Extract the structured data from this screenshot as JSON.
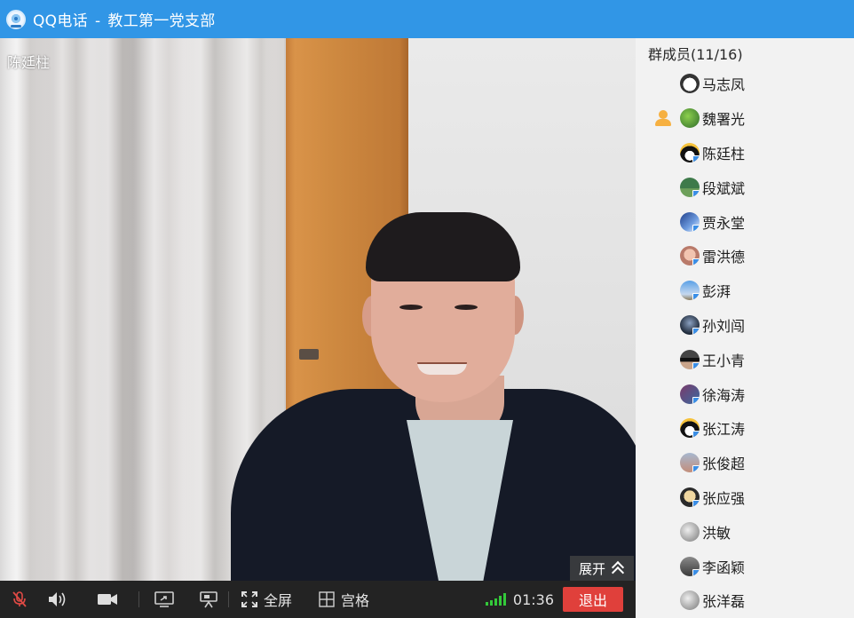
{
  "window": {
    "app_name": "QQ电话",
    "separator": "-",
    "group_name": "教工第一党支部"
  },
  "video": {
    "speaker_name": "陈廷柱",
    "expand_label": "展开"
  },
  "toolbar": {
    "fullscreen_label": "全屏",
    "grid_label": "宫格",
    "call_duration": "01:36",
    "quit_label": "退出",
    "signal_color": "#33c93a",
    "quit_color": "#e0403b"
  },
  "members": {
    "title": "群成员(11/16)",
    "items": [
      {
        "name": "马志凤",
        "avatar": "panda-avatar",
        "speaking": false
      },
      {
        "name": "魏署光",
        "avatar": "green-avatar",
        "speaking": true
      },
      {
        "name": "陈廷柱",
        "avatar": "penguin-avatar",
        "speaking": false
      },
      {
        "name": "段斌斌",
        "avatar": "landscape-avatar",
        "speaking": false
      },
      {
        "name": "贾永堂",
        "avatar": "blue-photo-avatar",
        "speaking": false
      },
      {
        "name": "雷洪德",
        "avatar": "face-avatar",
        "speaking": false
      },
      {
        "name": "彭湃",
        "avatar": "blue-sky-avatar",
        "speaking": false
      },
      {
        "name": "孙刘闯",
        "avatar": "dark-photo-avatar",
        "speaking": false
      },
      {
        "name": "王小青",
        "avatar": "sunglasses-avatar",
        "speaking": false
      },
      {
        "name": "徐海涛",
        "avatar": "group-photo-avatar",
        "speaking": false
      },
      {
        "name": "张江涛",
        "avatar": "penguin-avatar",
        "speaking": false
      },
      {
        "name": "张俊超",
        "avatar": "crowd-avatar",
        "speaking": false
      },
      {
        "name": "张应强",
        "avatar": "cartoon-avatar",
        "speaking": false
      },
      {
        "name": "洪敏",
        "avatar": "gray-avatar",
        "speaking": false
      },
      {
        "name": "李函颖",
        "avatar": "street-avatar",
        "speaking": false
      },
      {
        "name": "张洋磊",
        "avatar": "gray-avatar",
        "speaking": false
      }
    ]
  }
}
